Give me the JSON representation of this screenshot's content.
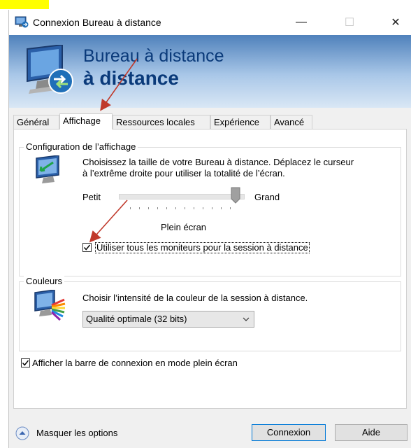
{
  "window": {
    "title": "Connexion Bureau à distance",
    "minimize_glyph": "—",
    "maximize_glyph": "☐",
    "close_glyph": "✕"
  },
  "banner": {
    "line1": "Bureau à distance",
    "line2": "à distance"
  },
  "tabs": [
    {
      "label": "Général",
      "active": false
    },
    {
      "label": "Affichage",
      "active": true
    },
    {
      "label": "Ressources locales",
      "active": false
    },
    {
      "label": "Expérience",
      "active": false
    },
    {
      "label": "Avancé",
      "active": false
    }
  ],
  "display": {
    "group_title": "Configuration de l’affichage",
    "description": "Choisissez la taille de votre Bureau à distance. Déplacez le curseur à l’extrême droite pour utiliser la totalité de l’écran.",
    "slider_min_label": "Petit",
    "slider_max_label": "Grand",
    "slider_value_label": "Plein écran",
    "slider_level": 1.0,
    "all_monitors_label": "Utiliser tous les moniteurs pour la session à distance",
    "all_monitors_checked": true
  },
  "colors": {
    "group_title": "Couleurs",
    "description": "Choisir l’intensité de la couleur de la session à distance.",
    "selected_option": "Qualité optimale (32 bits)"
  },
  "connection_bar": {
    "label": "Afficher la barre de connexion en mode plein écran",
    "checked": true
  },
  "footer": {
    "hide_options_label": "Masquer les options",
    "connect_label": "Connexion",
    "help_label": "Aide"
  },
  "theme": {
    "banner_text": "#0a3a7a",
    "annotation_arrow": "#c0392b",
    "highlight": "#ffff00",
    "accent": "#0078d7"
  }
}
